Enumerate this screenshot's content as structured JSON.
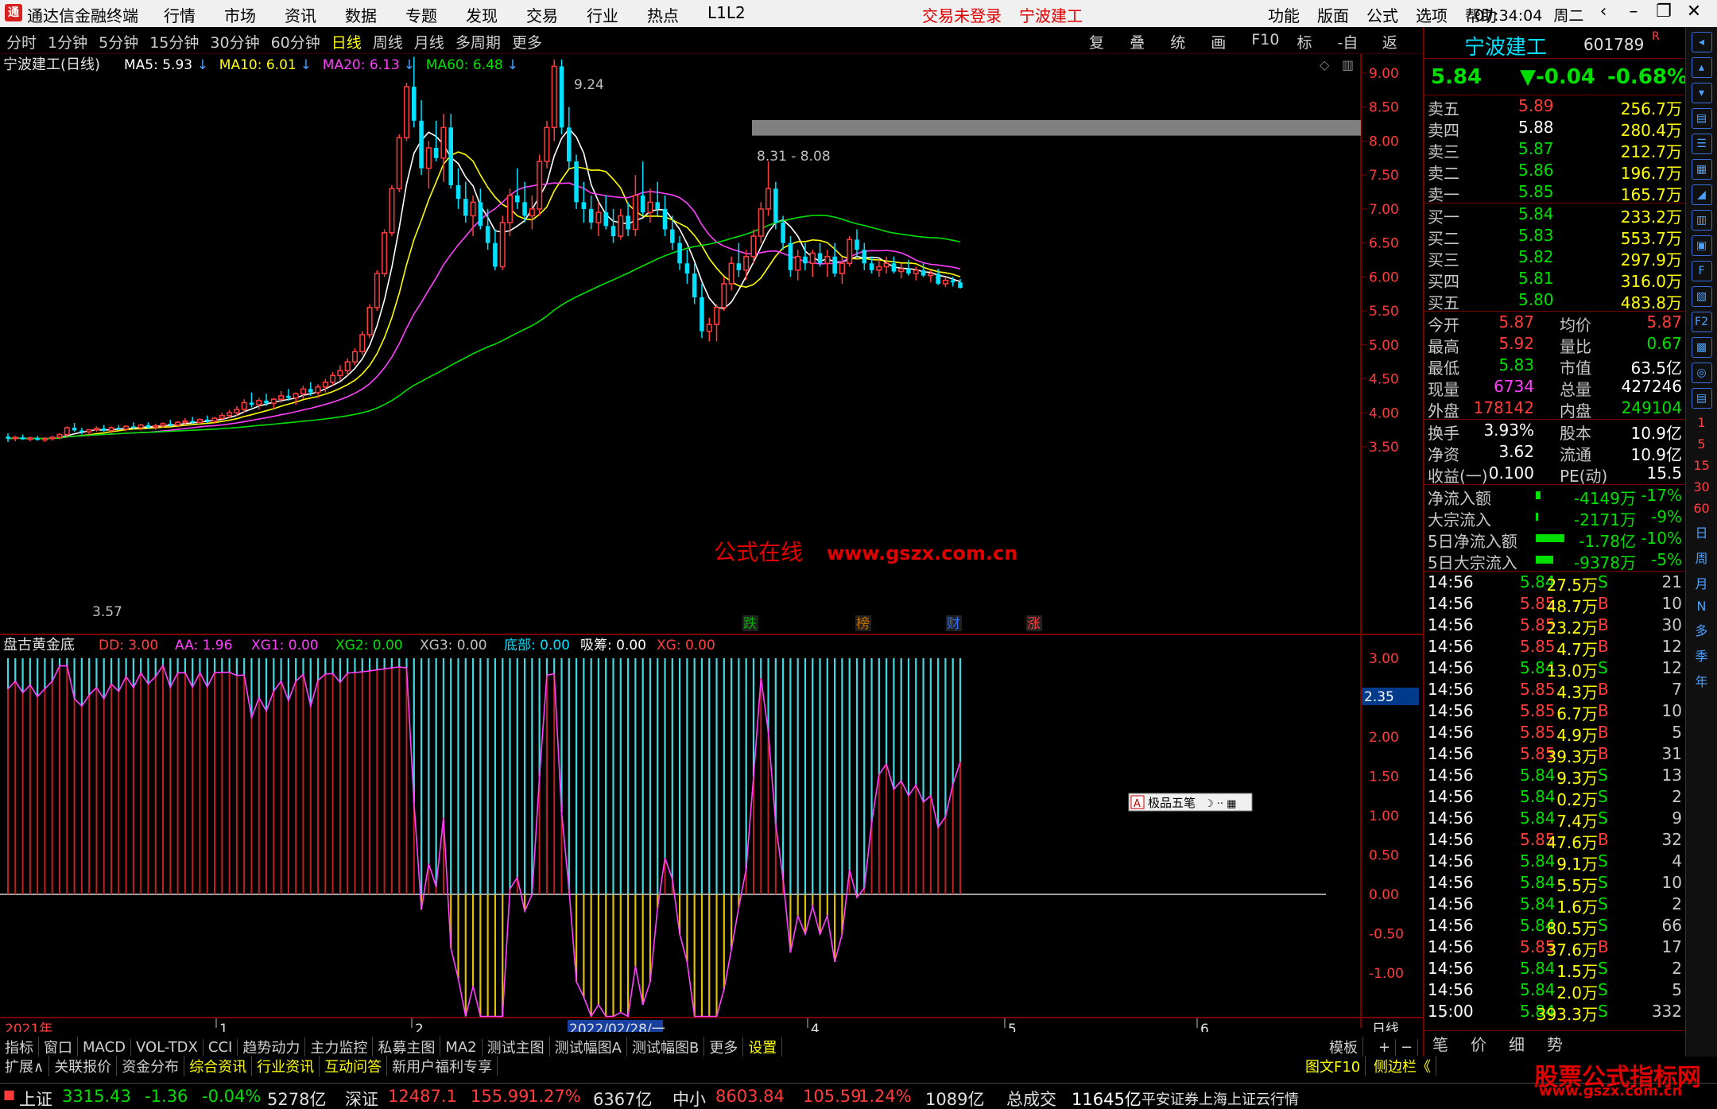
{
  "titlebar": {
    "app_name": "通达信金融终端",
    "menu": [
      "行情",
      "市场",
      "资讯",
      "数据",
      "专题",
      "发现",
      "交易",
      "行业",
      "热点",
      "L1L2"
    ],
    "trade_status": "交易未登录",
    "stock": "宁波建工",
    "right_menu": [
      "功能",
      "版面",
      "公式",
      "选项",
      "帮助"
    ],
    "time": "07:34:04",
    "weekday": "周二"
  },
  "toolbar": {
    "periods": [
      "分时",
      "1分钟",
      "5分钟",
      "15分钟",
      "30分钟",
      "60分钟",
      "日线",
      "周线",
      "月线",
      "多周期",
      "更多"
    ],
    "active_period": "日线",
    "tools": [
      "复权",
      "叠加",
      "统计",
      "画线",
      "F10",
      "标记",
      "-自选",
      "返回"
    ]
  },
  "main_chart": {
    "title": "宁波建工(日线)",
    "ma": [
      {
        "label": "MA5: 5.93",
        "color": "#ffffff"
      },
      {
        "label": "MA10: 6.01",
        "color": "#ffff00"
      },
      {
        "label": "MA20: 6.13",
        "color": "#ff40ff"
      },
      {
        "label": "MA60: 6.48",
        "color": "#00e000"
      }
    ],
    "high_label": "9.24",
    "low_label": "3.57",
    "gap_label": "8.31 - 8.08",
    "watermark": "公式在线",
    "watermark_url": "www.gszx.com.cn",
    "event_markers": [
      "跌",
      "榜",
      "财",
      "涨"
    ],
    "y_ticks": [
      "9.00",
      "8.50",
      "8.00",
      "7.50",
      "7.00",
      "6.50",
      "6.00",
      "5.50",
      "5.00",
      "4.50",
      "4.00",
      "3.50"
    ]
  },
  "sub_chart": {
    "title": "盘古黄金底",
    "params": [
      {
        "label": "DD: 3.00",
        "color": "#ff4040"
      },
      {
        "label": "AA: 1.96",
        "color": "#ff40ff"
      },
      {
        "label": "XG1: 0.00",
        "color": "#ff40ff"
      },
      {
        "label": "XG2: 0.00",
        "color": "#00e000"
      },
      {
        "label": "XG3: 0.00",
        "color": "#c0c0c0"
      },
      {
        "label": "底部: 0.00",
        "color": "#00e0ff"
      },
      {
        "label": "吸筹: 0.00",
        "color": "#ffffff"
      },
      {
        "label": "XG: 0.00",
        "color": "#ff4040"
      }
    ],
    "current_value": "2.35",
    "y_ticks": [
      "3.00",
      "2.50",
      "2.00",
      "1.50",
      "1.00",
      "0.50",
      "0.00",
      "-0.50",
      "-1.00"
    ],
    "ime_toolbar": "极品五笔"
  },
  "x_axis": {
    "labels": [
      "2021年",
      "1",
      "2",
      "2022/02/28/一",
      "4",
      "5",
      "6"
    ],
    "period": "日线"
  },
  "chart_data": {
    "type": "candlestick",
    "title": "宁波建工(日线)",
    "ylim": [
      3.4,
      9.3
    ],
    "ohlc_approx": [
      [
        3.65,
        3.7,
        3.57,
        3.62
      ],
      [
        3.62,
        3.66,
        3.58,
        3.64
      ],
      [
        3.64,
        3.68,
        3.6,
        3.61
      ],
      [
        3.61,
        3.65,
        3.58,
        3.63
      ],
      [
        3.63,
        3.66,
        3.59,
        3.6
      ],
      [
        3.6,
        3.64,
        3.57,
        3.62
      ],
      [
        3.62,
        3.66,
        3.59,
        3.64
      ],
      [
        3.64,
        3.7,
        3.61,
        3.68
      ],
      [
        3.68,
        3.8,
        3.65,
        3.78
      ],
      [
        3.78,
        3.85,
        3.72,
        3.74
      ],
      [
        3.74,
        3.78,
        3.68,
        3.72
      ],
      [
        3.72,
        3.76,
        3.68,
        3.75
      ],
      [
        3.75,
        3.8,
        3.72,
        3.77
      ],
      [
        3.77,
        3.82,
        3.72,
        3.74
      ],
      [
        3.74,
        3.8,
        3.7,
        3.78
      ],
      [
        3.78,
        3.82,
        3.74,
        3.76
      ],
      [
        3.76,
        3.82,
        3.73,
        3.8
      ],
      [
        3.8,
        3.86,
        3.76,
        3.78
      ],
      [
        3.78,
        3.84,
        3.74,
        3.82
      ],
      [
        3.82,
        3.86,
        3.76,
        3.79
      ],
      [
        3.79,
        3.84,
        3.75,
        3.81
      ],
      [
        3.81,
        3.86,
        3.78,
        3.84
      ],
      [
        3.84,
        3.9,
        3.8,
        3.82
      ],
      [
        3.82,
        3.88,
        3.78,
        3.86
      ],
      [
        3.86,
        3.92,
        3.82,
        3.88
      ],
      [
        3.88,
        3.94,
        3.84,
        3.86
      ],
      [
        3.86,
        3.92,
        3.82,
        3.9
      ],
      [
        3.9,
        3.96,
        3.85,
        3.88
      ],
      [
        3.88,
        3.94,
        3.84,
        3.92
      ],
      [
        3.92,
        4.0,
        3.88,
        3.96
      ],
      [
        3.96,
        4.04,
        3.92,
        4.0
      ],
      [
        4.0,
        4.1,
        3.95,
        4.05
      ],
      [
        4.05,
        4.2,
        4.0,
        4.15
      ],
      [
        4.15,
        4.3,
        4.08,
        4.12
      ],
      [
        4.12,
        4.22,
        4.05,
        4.18
      ],
      [
        4.18,
        4.28,
        4.1,
        4.14
      ],
      [
        4.14,
        4.22,
        4.06,
        4.2
      ],
      [
        4.2,
        4.32,
        4.15,
        4.25
      ],
      [
        4.25,
        4.35,
        4.18,
        4.22
      ],
      [
        4.22,
        4.3,
        4.12,
        4.28
      ],
      [
        4.28,
        4.4,
        4.2,
        4.35
      ],
      [
        4.35,
        4.45,
        4.25,
        4.3
      ],
      [
        4.3,
        4.42,
        4.22,
        4.38
      ],
      [
        4.38,
        4.5,
        4.3,
        4.45
      ],
      [
        4.45,
        4.6,
        4.4,
        4.55
      ],
      [
        4.55,
        4.7,
        4.48,
        4.62
      ],
      [
        4.62,
        4.8,
        4.55,
        4.75
      ],
      [
        4.75,
        4.95,
        4.7,
        4.9
      ],
      [
        4.9,
        5.2,
        4.85,
        5.15
      ],
      [
        5.15,
        5.6,
        5.1,
        5.55
      ],
      [
        5.55,
        6.1,
        5.5,
        6.05
      ],
      [
        6.05,
        6.7,
        6.0,
        6.65
      ],
      [
        6.65,
        7.35,
        6.6,
        7.3
      ],
      [
        7.3,
        8.1,
        7.25,
        8.05
      ],
      [
        8.05,
        8.86,
        8.0,
        8.8
      ],
      [
        8.8,
        9.24,
        8.2,
        8.3
      ],
      [
        8.3,
        8.6,
        7.5,
        7.6
      ],
      [
        7.6,
        8.0,
        7.3,
        7.9
      ],
      [
        7.9,
        8.3,
        7.7,
        7.75
      ],
      [
        7.75,
        8.4,
        7.4,
        8.2
      ],
      [
        8.2,
        8.4,
        7.3,
        7.35
      ],
      [
        7.35,
        7.6,
        7.0,
        7.15
      ],
      [
        7.15,
        7.4,
        6.8,
        6.9
      ],
      [
        6.9,
        7.2,
        6.6,
        7.1
      ],
      [
        7.1,
        7.3,
        6.7,
        6.75
      ],
      [
        6.75,
        7.0,
        6.4,
        6.5
      ],
      [
        6.5,
        6.7,
        6.1,
        6.15
      ],
      [
        6.15,
        6.9,
        6.1,
        6.8
      ],
      [
        6.8,
        7.3,
        6.6,
        7.2
      ],
      [
        7.2,
        7.6,
        7.0,
        7.1
      ],
      [
        7.1,
        7.4,
        6.8,
        6.9
      ],
      [
        6.9,
        7.2,
        6.7,
        7.0
      ],
      [
        7.0,
        7.8,
        6.9,
        7.7
      ],
      [
        7.7,
        8.3,
        7.6,
        8.2
      ],
      [
        8.2,
        9.2,
        8.0,
        9.1
      ],
      [
        9.1,
        9.2,
        8.1,
        8.2
      ],
      [
        8.2,
        8.5,
        7.6,
        7.7
      ],
      [
        7.7,
        7.8,
        7.0,
        7.1
      ],
      [
        7.1,
        7.4,
        6.8,
        7.0
      ],
      [
        7.0,
        7.2,
        6.7,
        6.8
      ],
      [
        6.8,
        7.1,
        6.6,
        6.95
      ],
      [
        6.95,
        7.2,
        6.7,
        6.75
      ],
      [
        6.75,
        7.0,
        6.5,
        6.6
      ],
      [
        6.6,
        7.0,
        6.55,
        6.9
      ],
      [
        6.9,
        7.1,
        6.6,
        6.7
      ],
      [
        6.7,
        7.5,
        6.6,
        7.2
      ],
      [
        7.2,
        7.7,
        6.9,
        6.95
      ],
      [
        6.95,
        7.3,
        6.8,
        7.1
      ],
      [
        7.1,
        7.4,
        6.9,
        7.0
      ],
      [
        7.0,
        7.2,
        6.6,
        6.7
      ],
      [
        6.7,
        6.9,
        6.4,
        6.5
      ],
      [
        6.5,
        6.6,
        6.1,
        6.2
      ],
      [
        6.2,
        6.4,
        5.9,
        6.05
      ],
      [
        6.05,
        6.2,
        5.6,
        5.7
      ],
      [
        5.7,
        5.9,
        5.1,
        5.2
      ],
      [
        5.2,
        5.4,
        5.05,
        5.3
      ],
      [
        5.3,
        5.6,
        5.05,
        5.55
      ],
      [
        5.55,
        6.0,
        5.5,
        5.9
      ],
      [
        5.9,
        6.3,
        5.8,
        6.2
      ],
      [
        6.2,
        6.5,
        6.0,
        6.1
      ],
      [
        6.1,
        6.4,
        5.95,
        6.3
      ],
      [
        6.3,
        6.7,
        6.2,
        6.6
      ],
      [
        6.6,
        7.1,
        6.5,
        7.0
      ],
      [
        7.0,
        7.7,
        6.9,
        7.3
      ],
      [
        7.3,
        7.4,
        6.7,
        6.8
      ],
      [
        6.8,
        6.9,
        6.4,
        6.5
      ],
      [
        6.5,
        6.6,
        6.0,
        6.1
      ],
      [
        6.1,
        6.4,
        5.95,
        6.3
      ],
      [
        6.3,
        6.5,
        6.1,
        6.2
      ],
      [
        6.2,
        6.4,
        6.0,
        6.35
      ],
      [
        6.35,
        6.5,
        6.15,
        6.2
      ],
      [
        6.2,
        6.4,
        6.0,
        6.3
      ],
      [
        6.3,
        6.5,
        6.0,
        6.05
      ],
      [
        6.05,
        6.3,
        5.9,
        6.2
      ],
      [
        6.2,
        6.6,
        6.15,
        6.55
      ],
      [
        6.55,
        6.7,
        6.3,
        6.4
      ],
      [
        6.4,
        6.5,
        6.1,
        6.2
      ],
      [
        6.2,
        6.3,
        6.05,
        6.1
      ],
      [
        6.1,
        6.25,
        6.0,
        6.15
      ],
      [
        6.15,
        6.3,
        6.05,
        6.2
      ],
      [
        6.2,
        6.3,
        6.05,
        6.08
      ],
      [
        6.08,
        6.2,
        5.98,
        6.12
      ],
      [
        6.12,
        6.25,
        6.02,
        6.05
      ],
      [
        6.05,
        6.15,
        5.95,
        6.1
      ],
      [
        6.1,
        6.2,
        6.0,
        6.02
      ],
      [
        6.02,
        6.1,
        5.92,
        6.05
      ],
      [
        6.05,
        6.12,
        5.88,
        5.9
      ],
      [
        5.9,
        6.0,
        5.85,
        5.95
      ],
      [
        5.95,
        6.0,
        5.86,
        5.92
      ],
      [
        5.92,
        5.97,
        5.83,
        5.84
      ]
    ]
  },
  "rpanel": {
    "stock_name": "宁波建工",
    "stock_code": "601789",
    "price": "5.84",
    "change": "▼-0.04",
    "change_pct": "-0.68%",
    "asks": [
      {
        "label": "卖五",
        "price": "5.89",
        "vol": "256.7万"
      },
      {
        "label": "卖四",
        "price": "5.88",
        "vol": "280.4万"
      },
      {
        "label": "卖三",
        "price": "5.87",
        "vol": "212.7万"
      },
      {
        "label": "卖二",
        "price": "5.86",
        "vol": "196.7万"
      },
      {
        "label": "卖一",
        "price": "5.85",
        "vol": "165.7万"
      }
    ],
    "bids": [
      {
        "label": "买一",
        "price": "5.84",
        "vol": "233.2万"
      },
      {
        "label": "买二",
        "price": "5.83",
        "vol": "553.7万"
      },
      {
        "label": "买三",
        "price": "5.82",
        "vol": "297.9万"
      },
      {
        "label": "买四",
        "price": "5.81",
        "vol": "316.0万"
      },
      {
        "label": "买五",
        "price": "5.80",
        "vol": "483.8万"
      }
    ],
    "stats1": [
      {
        "l1": "今开",
        "v1": "5.87",
        "c1": "red",
        "l2": "均价",
        "v2": "5.87",
        "c2": "red"
      },
      {
        "l1": "最高",
        "v1": "5.92",
        "c1": "red",
        "l2": "量比",
        "v2": "0.67",
        "c2": "grn"
      },
      {
        "l1": "最低",
        "v1": "5.83",
        "c1": "grn",
        "l2": "市值",
        "v2": "63.5亿",
        "c2": "wht"
      },
      {
        "l1": "现量",
        "v1": "6734",
        "c1": "mag",
        "l2": "总量",
        "v2": "427246",
        "c2": "wht"
      },
      {
        "l1": "外盘",
        "v1": "178142",
        "c1": "red",
        "l2": "内盘",
        "v2": "249104",
        "c2": "grn"
      }
    ],
    "stats2": [
      {
        "l1": "换手",
        "v1": "3.93%",
        "l2": "股本",
        "v2": "10.9亿"
      },
      {
        "l1": "净资",
        "v1": "3.62",
        "l2": "流通",
        "v2": "10.9亿"
      },
      {
        "l1": "收益(一)",
        "v1": "0.100",
        "l2": "PE(动)",
        "v2": "15.5"
      }
    ],
    "flows": [
      {
        "label": "净流入额",
        "value": "-4149万",
        "pct": "-17%"
      },
      {
        "label": "大宗流入",
        "value": "-2171万",
        "pct": "-9%"
      },
      {
        "label": "5日净流入额",
        "value": "-1.78亿",
        "pct": "-10%"
      },
      {
        "label": "5日大宗流入",
        "value": "-9378万",
        "pct": "-5%"
      }
    ],
    "ticks": [
      {
        "t": "14:56",
        "p": "5.84",
        "v": "27.5万",
        "s": "S",
        "n": "21"
      },
      {
        "t": "14:56",
        "p": "5.85",
        "v": "48.7万",
        "s": "B",
        "n": "10"
      },
      {
        "t": "14:56",
        "p": "5.85",
        "v": "23.2万",
        "s": "B",
        "n": "30"
      },
      {
        "t": "14:56",
        "p": "5.85",
        "v": "4.7万",
        "s": "B",
        "n": "12"
      },
      {
        "t": "14:56",
        "p": "5.84",
        "v": "13.0万",
        "s": "S",
        "n": "12"
      },
      {
        "t": "14:56",
        "p": "5.85",
        "v": "4.3万",
        "s": "B",
        "n": "7"
      },
      {
        "t": "14:56",
        "p": "5.85",
        "v": "6.7万",
        "s": "B",
        "n": "10"
      },
      {
        "t": "14:56",
        "p": "5.85",
        "v": "4.9万",
        "s": "B",
        "n": "5"
      },
      {
        "t": "14:56",
        "p": "5.85",
        "v": "39.3万",
        "s": "B",
        "n": "31"
      },
      {
        "t": "14:56",
        "p": "5.84",
        "v": "9.3万",
        "s": "S",
        "n": "13"
      },
      {
        "t": "14:56",
        "p": "5.84",
        "v": "0.2万",
        "s": "S",
        "n": "2"
      },
      {
        "t": "14:56",
        "p": "5.84",
        "v": "7.4万",
        "s": "S",
        "n": "9"
      },
      {
        "t": "14:56",
        "p": "5.85",
        "v": "47.6万",
        "s": "B",
        "n": "32"
      },
      {
        "t": "14:56",
        "p": "5.84",
        "v": "9.1万",
        "s": "S",
        "n": "4"
      },
      {
        "t": "14:56",
        "p": "5.84",
        "v": "5.5万",
        "s": "S",
        "n": "10"
      },
      {
        "t": "14:56",
        "p": "5.84",
        "v": "1.6万",
        "s": "S",
        "n": "2"
      },
      {
        "t": "14:56",
        "p": "5.84",
        "v": "80.5万",
        "s": "S",
        "n": "66"
      },
      {
        "t": "14:56",
        "p": "5.85",
        "v": "37.6万",
        "s": "B",
        "n": "17"
      },
      {
        "t": "14:56",
        "p": "5.84",
        "v": "1.5万",
        "s": "S",
        "n": "2"
      },
      {
        "t": "14:56",
        "p": "5.84",
        "v": "2.0万",
        "s": "S",
        "n": "5"
      },
      {
        "t": "15:00",
        "p": "5.84",
        "v": "393.3万",
        "s": "S",
        "n": "332"
      }
    ],
    "bottom_tabs": [
      "笔",
      "价",
      "细",
      "势"
    ]
  },
  "sideicons": {
    "labels": [
      "1",
      "5",
      "15",
      "30",
      "60",
      "日",
      "周",
      "月",
      "N",
      "多",
      "季",
      "年"
    ],
    "icon_letters": [
      "◂",
      "▴",
      "▾",
      "▤",
      "☰",
      "▦",
      "◢",
      "▥",
      "▣",
      "F",
      "▧",
      "F2",
      "▩",
      "◎",
      "▤",
      "RSI",
      "✥",
      "✎",
      "F5",
      "▨"
    ]
  },
  "tabs1": {
    "items": [
      "指标",
      "窗口",
      "MACD",
      "VOL-TDX",
      "CCI",
      "趋势动力",
      "主力监控",
      "私募主图",
      "MA2",
      "测试主图",
      "测试幅图A",
      "测试幅图B",
      "更多",
      "设置"
    ],
    "right": "模板"
  },
  "tabs2": {
    "items": [
      "扩展∧",
      "关联报价",
      "资金分布",
      "综合资讯",
      "行业资讯",
      "互动问答",
      "新用户福利专享"
    ],
    "right": [
      "图文F10",
      "侧边栏《"
    ]
  },
  "statusbar": {
    "items": [
      {
        "name": "上证",
        "val": "3315.43",
        "chg": "-1.36",
        "pct": "-0.04%",
        "amt": "5278亿"
      },
      {
        "name": "深证",
        "val": "12487.1",
        "chg": "155.99",
        "pct": "1.27%",
        "amt": "6367亿"
      },
      {
        "name": "中小",
        "val": "8603.84",
        "chg": "105.59",
        "pct": "1.24%",
        "amt": "1089亿"
      }
    ],
    "total_label": "总成交",
    "total_value": "11645亿",
    "broker": "平安证券上海上证云行情"
  },
  "brand_watermark": "股票公式指标网",
  "brand_url": "www.gszx.com.cn",
  "colors": {
    "up": "#ff3c3c",
    "down": "#00e0ff",
    "ma5": "#ffffff",
    "ma10": "#ffff00",
    "ma20": "#ff40ff",
    "ma60": "#00e000",
    "grid": "#7a0000"
  }
}
